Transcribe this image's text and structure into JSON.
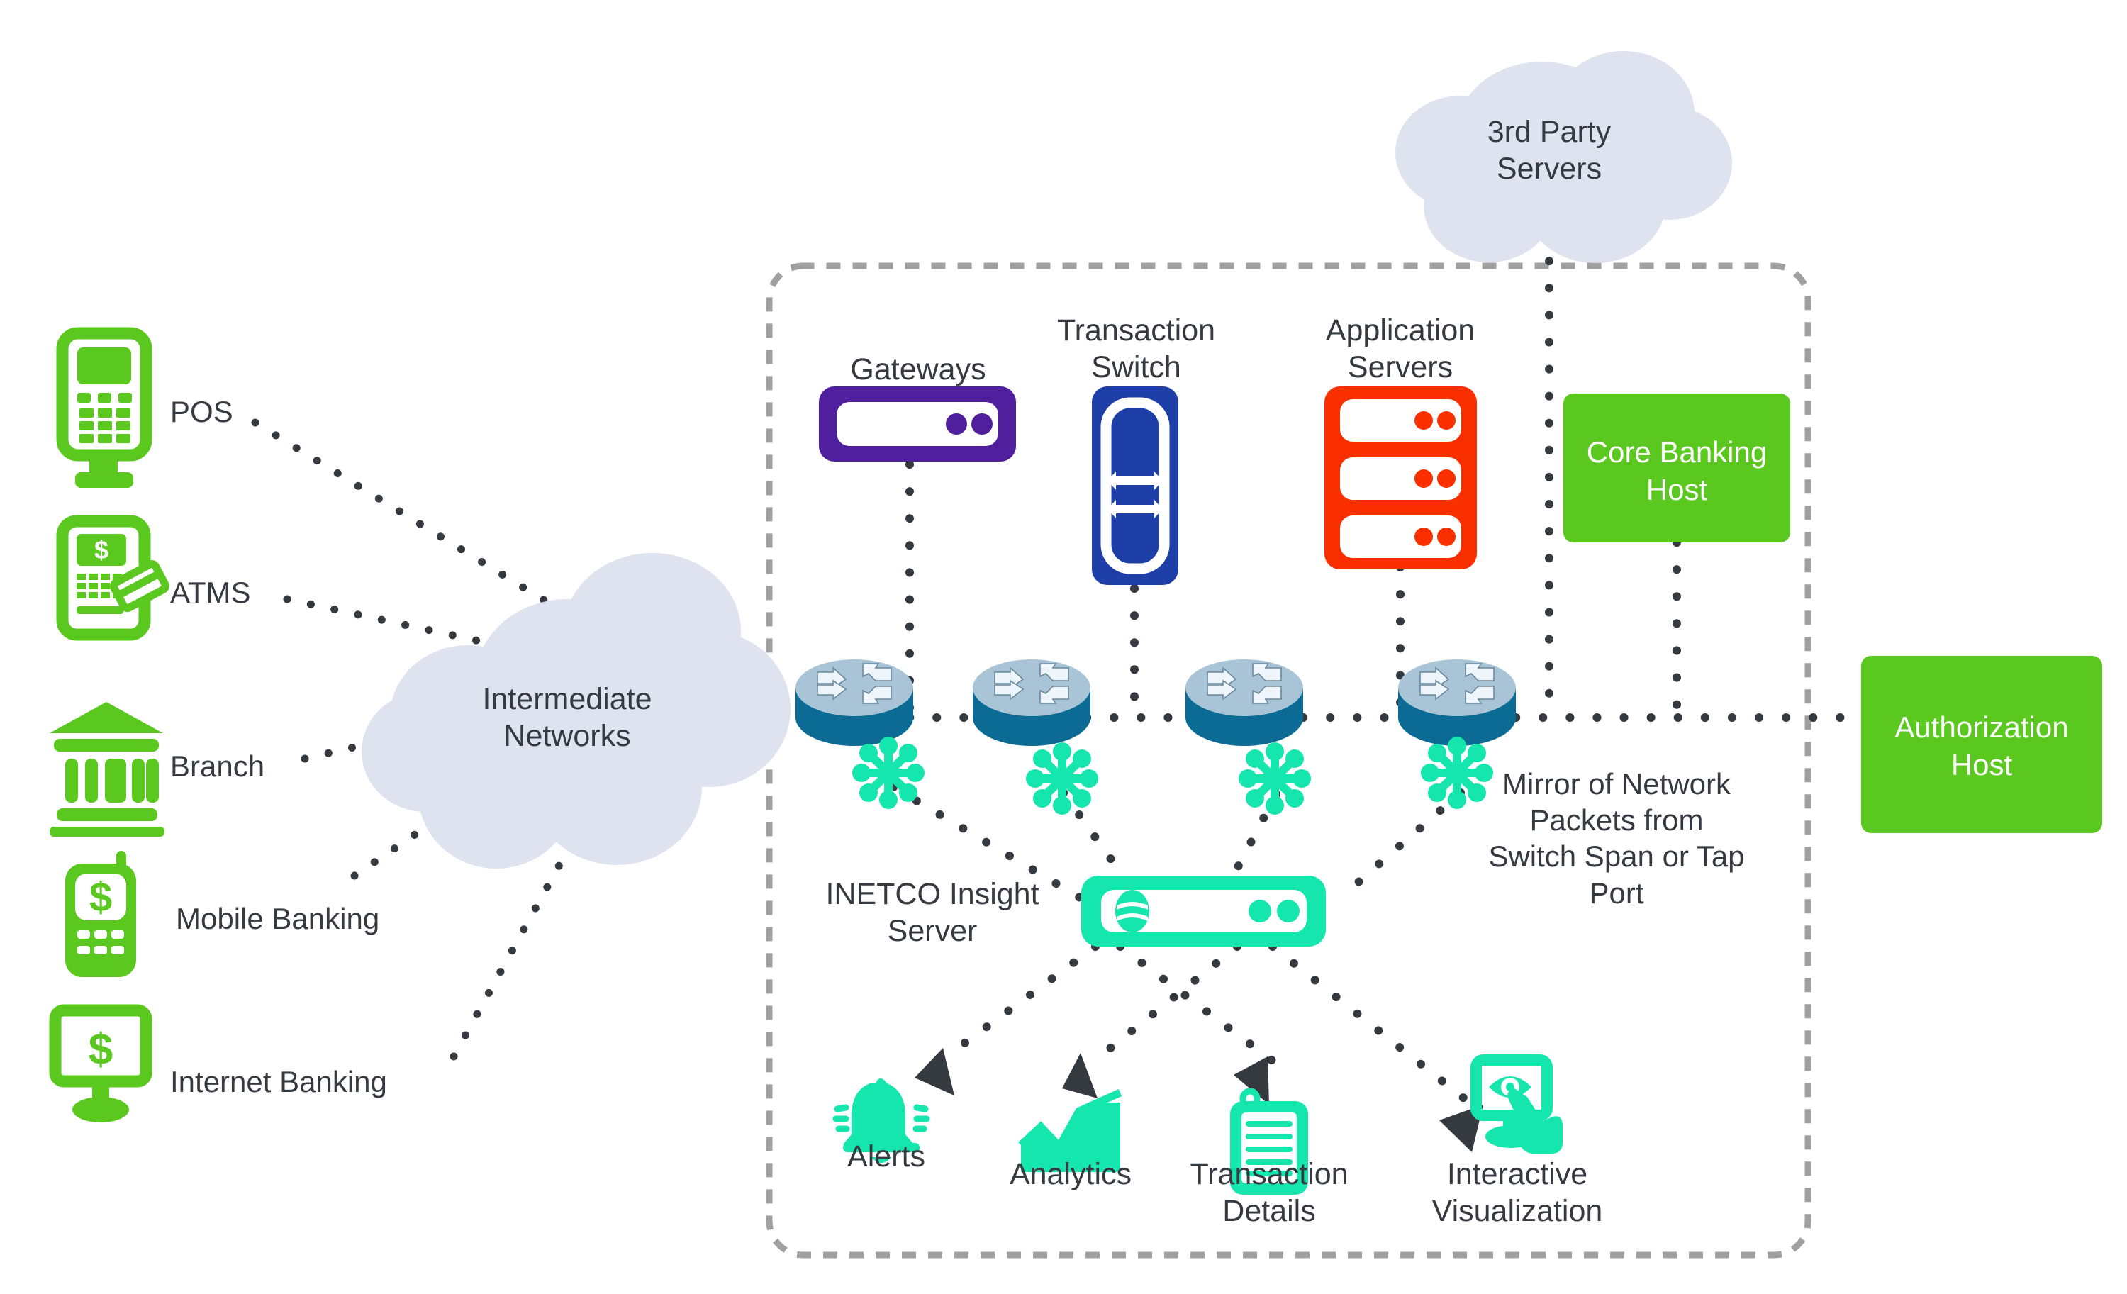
{
  "diagram": {
    "title": "INETCO Insight transaction monitoring network architecture",
    "colors": {
      "green": "#5ac81e",
      "green_icon": "#5ac81e",
      "purple": "#4c1d95",
      "purple_gateway": "#4f1f9e",
      "blue_switch": "#1f3fa8",
      "red_appserver": "#fa2f00",
      "teal": "#14e6ad",
      "cloud": "#dfe3f0",
      "router_top": "#a8c4d6",
      "router_body": "#0b6b94",
      "text": "#343a40",
      "dotted": "#343a40",
      "boundary": "#a0a0a0"
    },
    "channels": [
      {
        "id": "pos",
        "label": "POS",
        "icon": "pos-terminal-icon"
      },
      {
        "id": "atms",
        "label": "ATMS",
        "icon": "atm-machine-icon"
      },
      {
        "id": "branch",
        "label": "Branch",
        "icon": "bank-building-icon"
      },
      {
        "id": "mobile-banking",
        "label": "Mobile Banking",
        "icon": "mobile-phone-dollar-icon"
      },
      {
        "id": "internet-banking",
        "label": "Internet Banking",
        "icon": "desktop-monitor-dollar-icon"
      }
    ],
    "clouds": [
      {
        "id": "intermediate-networks",
        "label": "Intermediate\nNetworks",
        "line1": "Intermediate",
        "line2": "Networks"
      },
      {
        "id": "third-party-servers",
        "label": "3rd Party\nServers",
        "line1": "3rd Party",
        "line2": "Servers"
      }
    ],
    "infrastructure": [
      {
        "id": "gateways",
        "label": "Gateways",
        "line1": "Gateways",
        "line2": "",
        "icon": "gateway-server-icon"
      },
      {
        "id": "transaction-switch",
        "label": "Transaction Switch",
        "line1": "Transaction",
        "line2": "Switch",
        "icon": "transaction-switch-icon"
      },
      {
        "id": "application-servers",
        "label": "Application Servers",
        "line1": "Application",
        "line2": "Servers",
        "icon": "application-server-rack-icon"
      }
    ],
    "hosts": [
      {
        "id": "core-banking-host",
        "label": "Core Banking Host",
        "line1": "Core Banking",
        "line2": "Host"
      },
      {
        "id": "authorization-host",
        "label": "Authorization Host",
        "line1": "Authorization",
        "line2": "Host"
      }
    ],
    "routers": [
      {
        "id": "router-1",
        "icon": "router-icon",
        "tap": "network-tap-icon"
      },
      {
        "id": "router-2",
        "icon": "router-icon",
        "tap": "network-tap-icon"
      },
      {
        "id": "router-3",
        "icon": "router-icon",
        "tap": "network-tap-icon"
      },
      {
        "id": "router-4",
        "icon": "router-icon",
        "tap": "network-tap-icon"
      }
    ],
    "insight_server": {
      "id": "inetco-insight-server",
      "label": "INETCO Insight Server",
      "line1": "INETCO Insight",
      "line2": "Server",
      "icon": "inetco-insight-server-icon"
    },
    "mirror_note": {
      "id": "mirror-note",
      "line1": "Mirror of Network",
      "line2": "Packets from",
      "line3": "Switch Span or Tap",
      "line4": "Port"
    },
    "outputs": [
      {
        "id": "alerts",
        "line1": "Alerts",
        "line2": "",
        "icon": "bell-alert-icon"
      },
      {
        "id": "analytics",
        "line1": "Analytics",
        "line2": "",
        "icon": "analytics-chart-icon"
      },
      {
        "id": "transaction-details",
        "line1": "Transaction",
        "line2": "Details",
        "icon": "clipboard-details-icon"
      },
      {
        "id": "interactive-visualization",
        "line1": "Interactive",
        "line2": "Visualization",
        "icon": "eye-monitor-cursor-icon"
      }
    ]
  }
}
